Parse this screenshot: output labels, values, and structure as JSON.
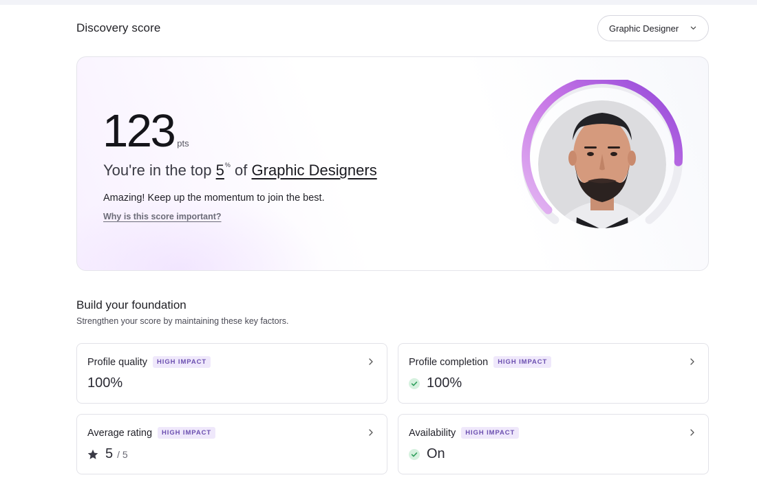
{
  "header": {
    "title": "Discovery score",
    "role_select": {
      "value": "Graphic Designer"
    }
  },
  "score_card": {
    "points": "123",
    "points_unit": "pts",
    "rank_prefix": "You're in the top",
    "rank_value": "5",
    "rank_percent_sign": "%",
    "rank_of": "of",
    "rank_group": "Graphic Designers",
    "message": "Amazing! Keep up the momentum to join the best.",
    "link_text": "Why is this score important?",
    "ring_progress": 0.85
  },
  "foundation": {
    "title": "Build your foundation",
    "subtitle": "Strengthen your score by maintaining these key factors.",
    "badge": "HIGH IMPACT",
    "cards": [
      {
        "name": "Profile quality",
        "value": "100%",
        "icon": ""
      },
      {
        "name": "Profile completion",
        "value": "100%",
        "icon": "check-circle-icon"
      },
      {
        "name": "Average rating",
        "value": "5",
        "suffix": "/ 5",
        "icon": "star-icon"
      },
      {
        "name": "Availability",
        "value": "On",
        "icon": "check-circle-icon"
      }
    ]
  },
  "colors": {
    "accent_purple": "#9b5de5",
    "badge_bg": "#efe8fb",
    "badge_text": "#6b4fb0",
    "check_green": "#2e9e5b"
  }
}
